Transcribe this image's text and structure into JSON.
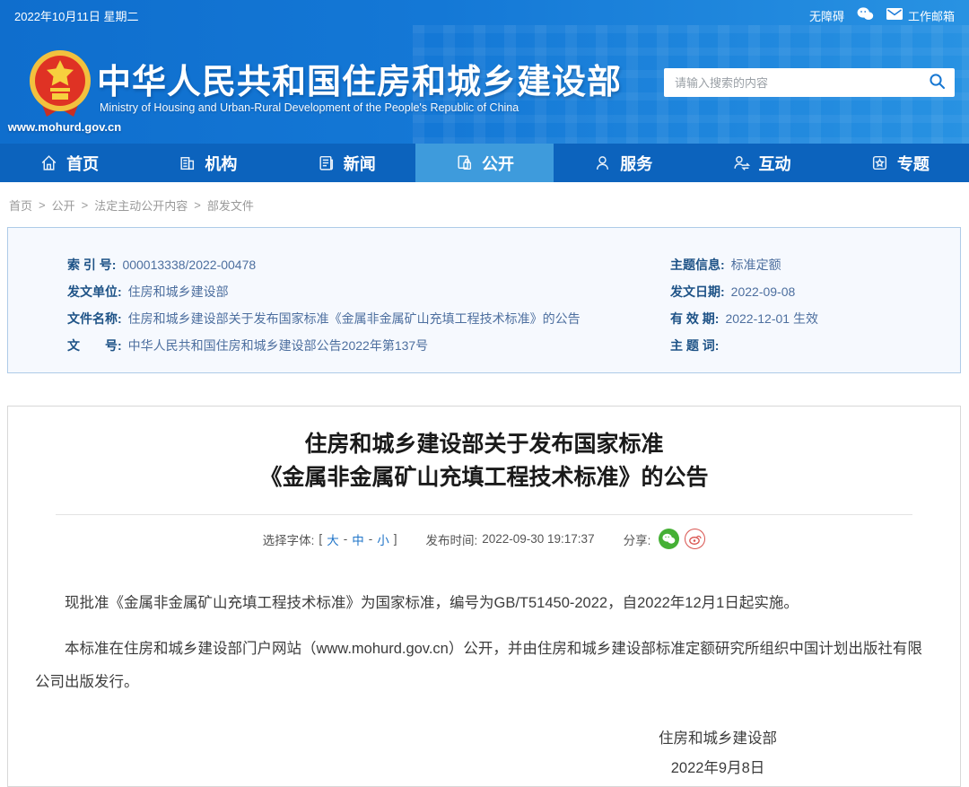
{
  "topbar": {
    "date": "2022年10月11日 星期二",
    "accessibility_label": "无障碍",
    "mailbox_label": "工作邮箱"
  },
  "header": {
    "site_title": "中华人民共和国住房和城乡建设部",
    "site_subtitle": "Ministry of Housing and Urban-Rural Development of the People's Republic of China",
    "site_url": "www.mohurd.gov.cn",
    "search_placeholder": "请输入搜索的内容"
  },
  "nav": {
    "items": [
      {
        "label": "首页",
        "icon": "home-icon",
        "active": false
      },
      {
        "label": "机构",
        "icon": "organization-icon",
        "active": false
      },
      {
        "label": "新闻",
        "icon": "news-icon",
        "active": false
      },
      {
        "label": "公开",
        "icon": "disclosure-icon",
        "active": true
      },
      {
        "label": "服务",
        "icon": "service-icon",
        "active": false
      },
      {
        "label": "互动",
        "icon": "interaction-icon",
        "active": false
      },
      {
        "label": "专题",
        "icon": "topics-icon",
        "active": false
      }
    ]
  },
  "breadcrumb": {
    "separator": ">",
    "parts": [
      "首页",
      "公开",
      "法定主动公开内容",
      "部发文件"
    ]
  },
  "doc_info": {
    "left": [
      {
        "label": "索 引 号:",
        "value": "000013338/2022-00478"
      },
      {
        "label": "发文单位:",
        "value": "住房和城乡建设部"
      },
      {
        "label": "文件名称:",
        "value": "住房和城乡建设部关于发布国家标准《金属非金属矿山充填工程技术标准》的公告"
      },
      {
        "label": "文　　号:",
        "value": "中华人民共和国住房和城乡建设部公告2022年第137号"
      }
    ],
    "right": [
      {
        "label": "主题信息:",
        "value": "标准定额"
      },
      {
        "label": "发文日期:",
        "value": "2022-09-08"
      },
      {
        "label": "有 效 期:",
        "value": "2022-12-01 生效"
      },
      {
        "label": "主 题 词:",
        "value": ""
      }
    ]
  },
  "article": {
    "title_line1": "住房和城乡建设部关于发布国家标准",
    "title_line2": "《金属非金属矿山充填工程技术标准》的公告",
    "font_selector": {
      "label": "选择字体:",
      "bracket_open": "[",
      "bracket_close": "]",
      "separator": "-",
      "options": [
        "大",
        "中",
        "小"
      ]
    },
    "publish_label": "发布时间:",
    "publish_time": "2022-09-30 19:17:37",
    "share_label": "分享:",
    "share_icons": [
      "wechat-share-icon",
      "weibo-share-icon"
    ],
    "paragraphs": [
      "现批准《金属非金属矿山充填工程技术标准》为国家标准，编号为GB/T51450-2022，自2022年12月1日起实施。",
      "本标准在住房和城乡建设部门户网站（www.mohurd.gov.cn）公开，并由住房和城乡建设部标准定额研究所组织中国计划出版社有限公司出版发行。"
    ],
    "signature": "住房和城乡建设部",
    "signature_date": "2022年9月8日"
  },
  "colors": {
    "header_blue": "#1478d6",
    "nav_blue": "#0c63bd",
    "active_tab_blue": "#3e9bdc",
    "link_blue": "#1f74c8",
    "info_label_blue": "#1d5286",
    "info_value_blue": "#4d6f9f",
    "wechat_green": "#45b035",
    "weibo_red": "#d9534f",
    "emblem_red": "#df3224",
    "emblem_gold": "#f2c13e"
  }
}
